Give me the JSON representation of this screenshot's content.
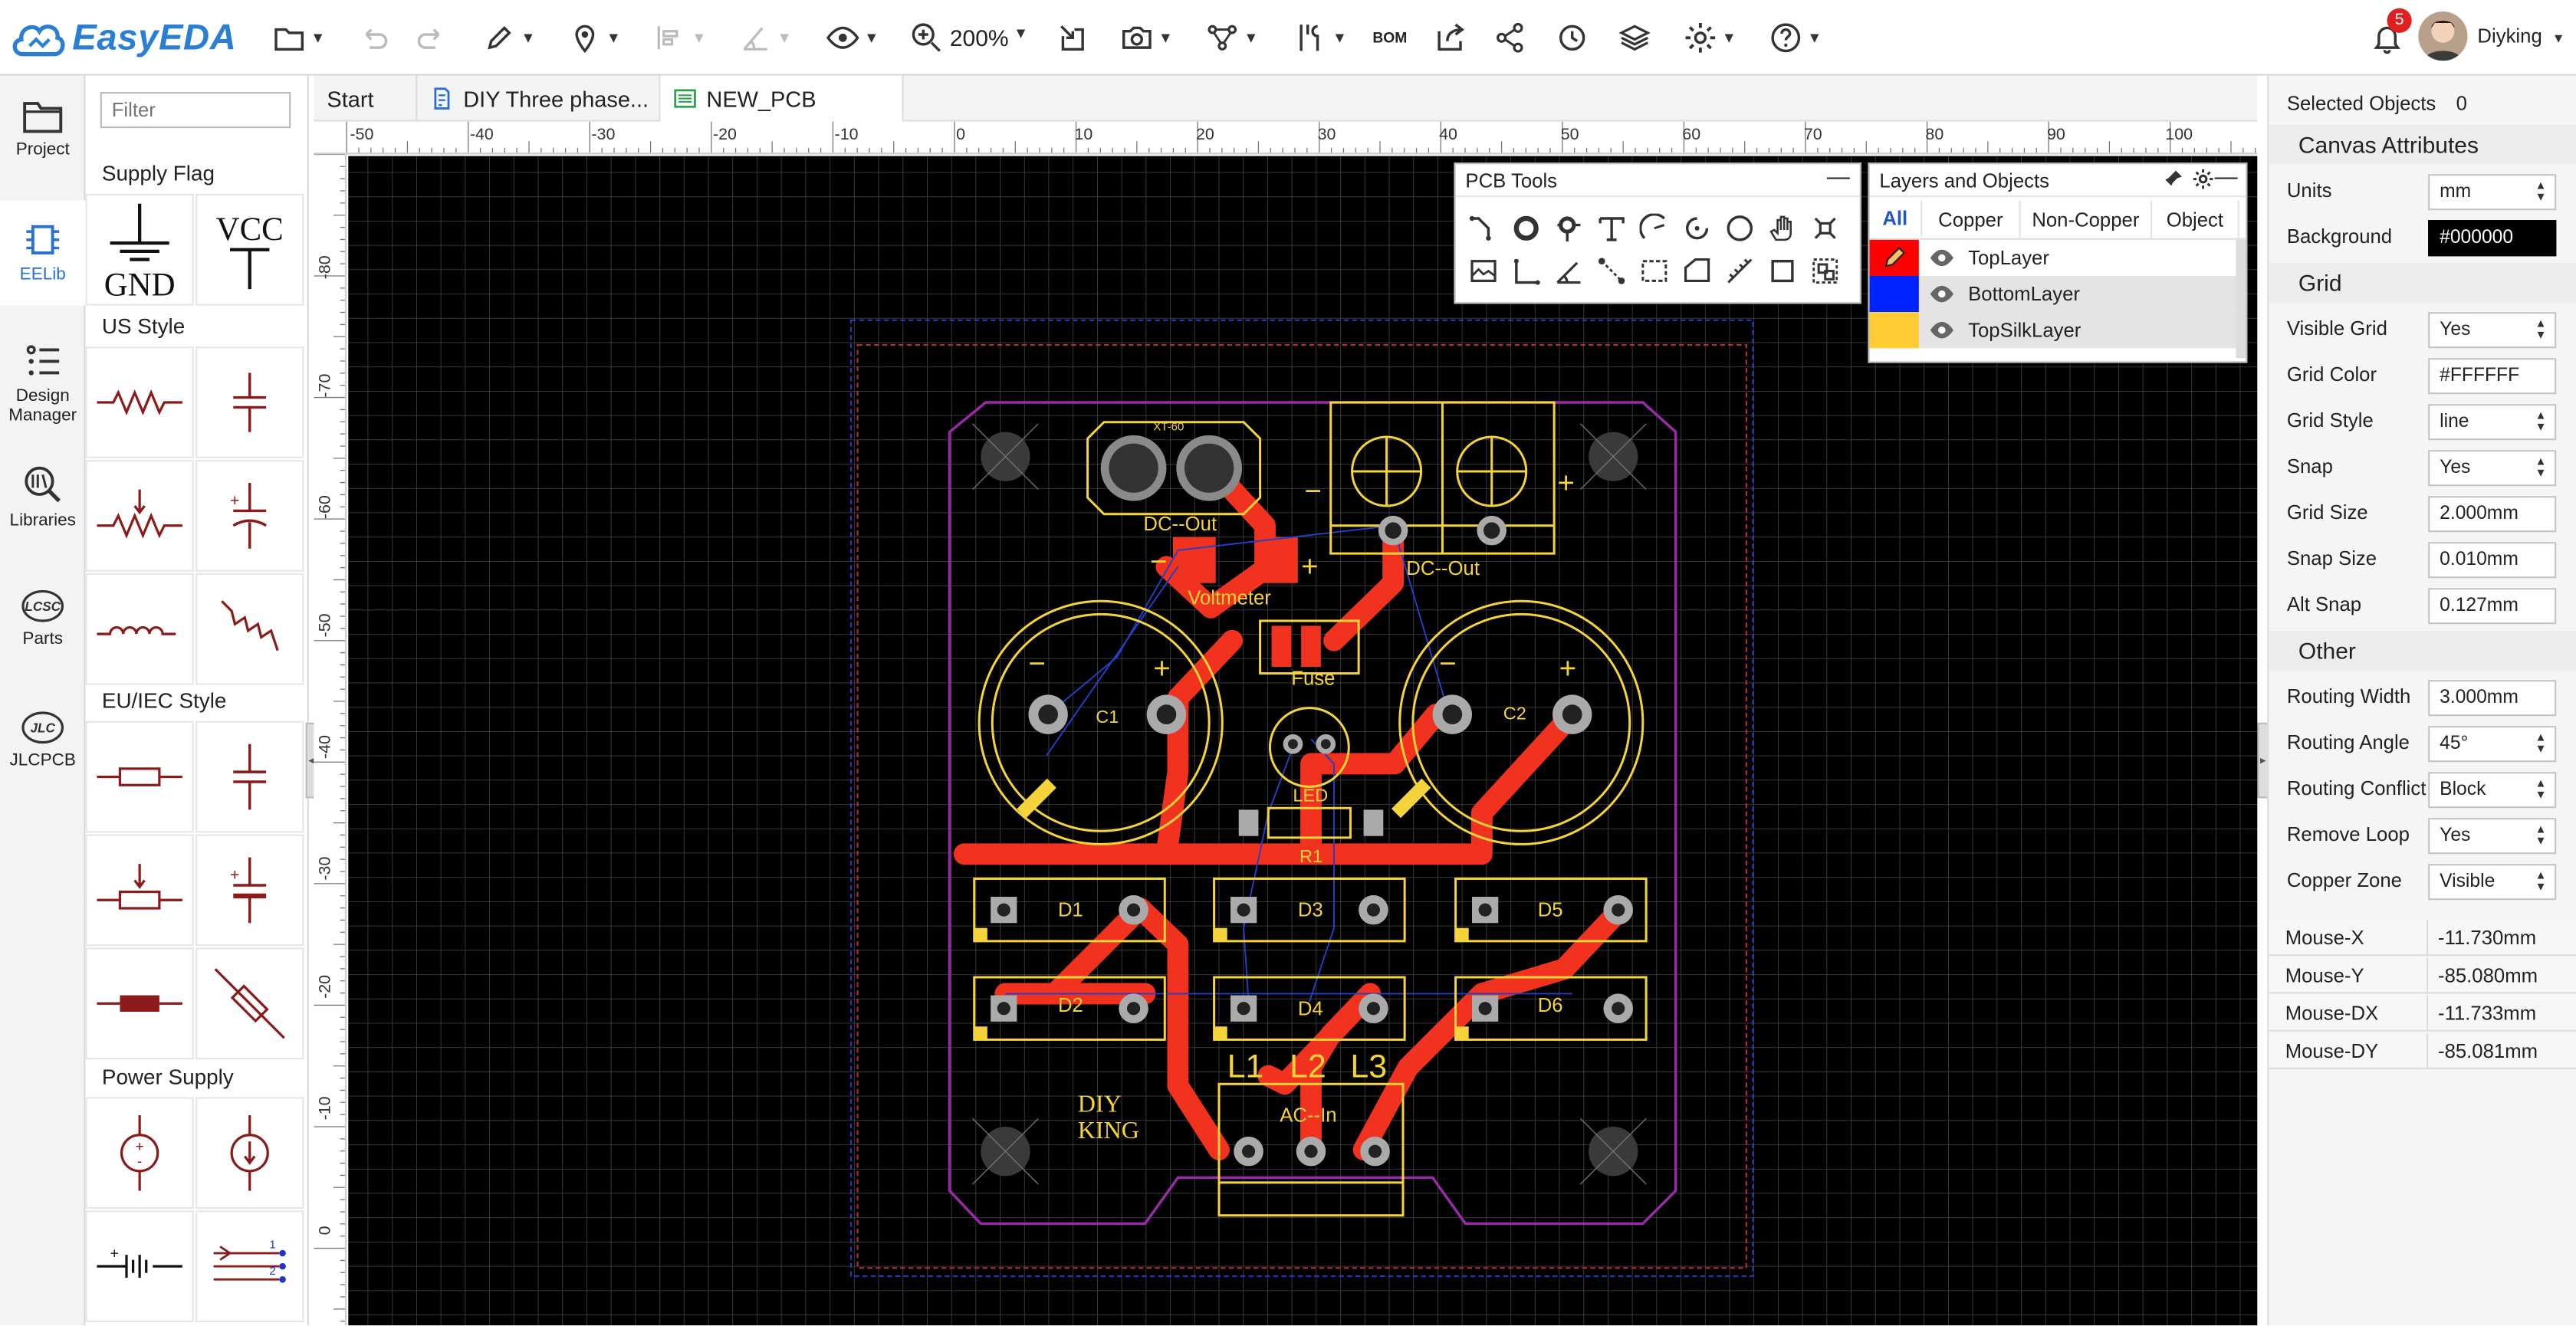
{
  "app": {
    "name": "EasyEDA"
  },
  "toolbar": {
    "zoom": "200%",
    "bom": "BOM",
    "notification_count": "5",
    "user": "Diyking"
  },
  "left_nav": [
    {
      "label": "Project"
    },
    {
      "label": "EELib"
    },
    {
      "label": "Design Manager"
    },
    {
      "label": "Libraries"
    },
    {
      "label": "Parts"
    },
    {
      "label": "JLCPCB"
    }
  ],
  "library": {
    "filter_placeholder": "Filter",
    "sections": [
      "Supply Flag",
      "US Style",
      "EU/IEC Style",
      "Power Supply"
    ],
    "gnd_label": "GND",
    "vcc_label": "VCC"
  },
  "tabs": [
    {
      "label": "Start"
    },
    {
      "label": "DIY Three phase..."
    },
    {
      "label": "NEW_PCB"
    }
  ],
  "ruler_h": [
    "-50",
    "-40",
    "-30",
    "-20",
    "-10",
    "0",
    "10",
    "20",
    "30",
    "40",
    "50",
    "60",
    "70",
    "80",
    "90",
    "100"
  ],
  "ruler_v": [
    "-80",
    "-70",
    "-60",
    "-50",
    "-40",
    "-30",
    "-20",
    "-10",
    "0"
  ],
  "pcb_tools": {
    "title": "PCB Tools"
  },
  "layers_panel": {
    "title": "Layers and Objects",
    "tabs": [
      "All",
      "Copper",
      "Non-Copper",
      "Object"
    ],
    "layers": [
      {
        "name": "TopLayer",
        "color": "#ff0000"
      },
      {
        "name": "BottomLayer",
        "color": "#0000ff"
      },
      {
        "name": "TopSilkLayer",
        "color": "#ffcc33"
      }
    ]
  },
  "pcb": {
    "labels": {
      "xt60": "XT-60",
      "dc_out_1": "DC--Out",
      "dc_out_2": "DC--Out",
      "voltmeter": "Voltmeter",
      "fuse": "Fuse",
      "c1": "C1",
      "c2": "C2",
      "led": "LED",
      "r1": "R1",
      "d1": "D1",
      "d2": "D2",
      "d3": "D3",
      "d4": "D4",
      "d5": "D5",
      "d6": "D6",
      "l1": "L1",
      "l2": "L2",
      "l3": "L3",
      "ac_in": "AC--In",
      "diy": "DIY",
      "king": "KING",
      "plus": "+",
      "minus": "−"
    },
    "colors": {
      "copper": "#f0321e",
      "silk": "#f5d33a",
      "outline": "#9a2aa8",
      "grid": "#555555"
    }
  },
  "properties": {
    "selected_label": "Selected Objects",
    "selected_count": "0",
    "canvas_title": "Canvas Attributes",
    "units_label": "Units",
    "units": "mm",
    "background_label": "Background",
    "background": "#000000",
    "grid_title": "Grid",
    "visible_grid_label": "Visible Grid",
    "visible_grid": "Yes",
    "grid_color_label": "Grid Color",
    "grid_color": "#FFFFFF",
    "grid_style_label": "Grid Style",
    "grid_style": "line",
    "snap_label": "Snap",
    "snap": "Yes",
    "grid_size_label": "Grid Size",
    "grid_size": "2.000mm",
    "snap_size_label": "Snap Size",
    "snap_size": "0.010mm",
    "alt_snap_label": "Alt Snap",
    "alt_snap": "0.127mm",
    "other_title": "Other",
    "routing_width_label": "Routing Width",
    "routing_width": "3.000mm",
    "routing_angle_label": "Routing Angle",
    "routing_angle": "45°",
    "routing_conflict_label": "Routing Conflict",
    "routing_conflict": "Block",
    "remove_loop_label": "Remove Loop",
    "remove_loop": "Yes",
    "copper_zone_label": "Copper Zone",
    "copper_zone": "Visible"
  },
  "mouse": [
    {
      "label": "Mouse-X",
      "value": "-11.730mm"
    },
    {
      "label": "Mouse-Y",
      "value": "-85.080mm"
    },
    {
      "label": "Mouse-DX",
      "value": "-11.733mm"
    },
    {
      "label": "Mouse-DY",
      "value": "-85.081mm"
    }
  ]
}
